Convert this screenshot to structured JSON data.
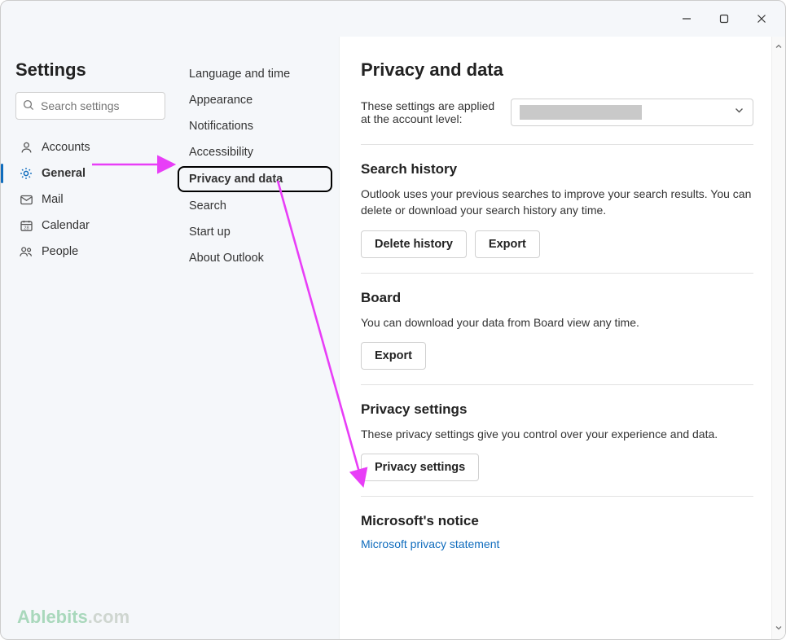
{
  "page_title": "Settings",
  "search": {
    "placeholder": "Search settings"
  },
  "nav": {
    "items": [
      {
        "label": "Accounts"
      },
      {
        "label": "General",
        "active": true
      },
      {
        "label": "Mail"
      },
      {
        "label": "Calendar"
      },
      {
        "label": "People"
      }
    ]
  },
  "subnav": {
    "items": [
      {
        "label": "Language and time"
      },
      {
        "label": "Appearance"
      },
      {
        "label": "Notifications"
      },
      {
        "label": "Accessibility"
      },
      {
        "label": "Privacy and data",
        "active": true
      },
      {
        "label": "Search"
      },
      {
        "label": "Start up"
      },
      {
        "label": "About Outlook"
      }
    ]
  },
  "main": {
    "title": "Privacy and data",
    "account_text": "These settings are applied at the account level:",
    "search_history": {
      "title": "Search history",
      "desc": "Outlook uses your previous searches to improve your search results. You can delete or download your search history any time.",
      "delete_label": "Delete history",
      "export_label": "Export"
    },
    "board": {
      "title": "Board",
      "desc": "You can download your data from Board view any time.",
      "export_label": "Export"
    },
    "privacy": {
      "title": "Privacy settings",
      "desc": "These privacy settings give you control over your experience and data.",
      "button_label": "Privacy settings"
    },
    "notice": {
      "title": "Microsoft's notice",
      "link_label": "Microsoft privacy statement"
    }
  },
  "watermark": {
    "brand": "Ablebits",
    "suffix": ".com"
  },
  "colors": {
    "accent": "#0f6cbd",
    "annotation": "#e83ef7"
  }
}
